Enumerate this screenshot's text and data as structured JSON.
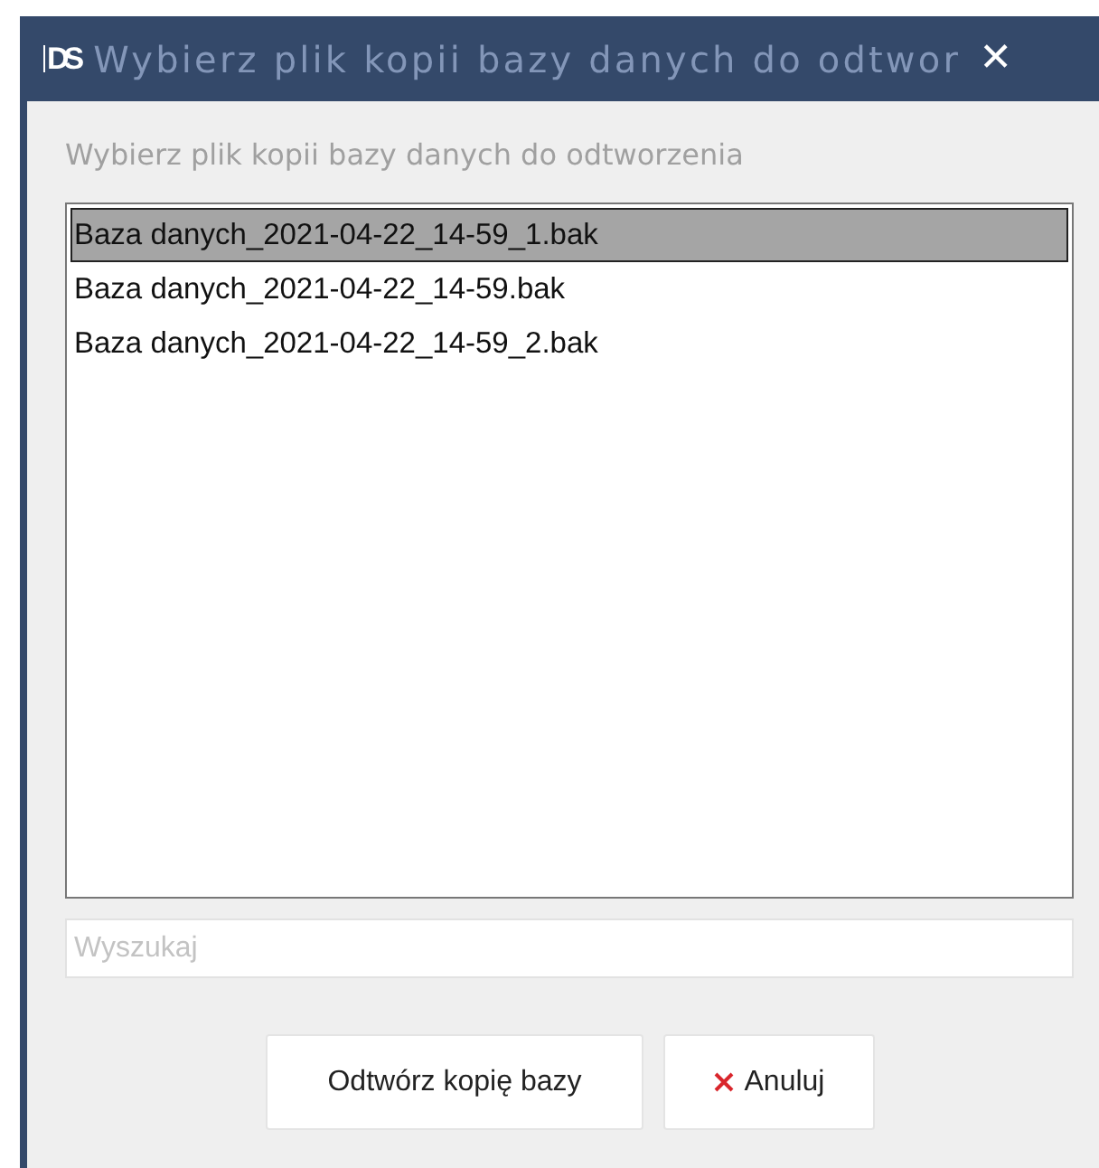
{
  "window": {
    "logo": "DS",
    "title": "Wybierz plik kopii bazy danych do odtwor",
    "close": "✕"
  },
  "prompt": "Wybierz plik kopii bazy danych do odtworzenia",
  "files": [
    {
      "name": "Baza danych_2021-04-22_14-59_1.bak",
      "selected": true
    },
    {
      "name": "Baza danych_2021-04-22_14-59.bak",
      "selected": false
    },
    {
      "name": "Baza danych_2021-04-22_14-59_2.bak",
      "selected": false
    }
  ],
  "search": {
    "placeholder": "Wyszukaj"
  },
  "buttons": [
    {
      "label": "Odtwórz kopię bazy",
      "kind": "restore"
    },
    {
      "label": "Anuluj",
      "kind": "cancel"
    }
  ]
}
